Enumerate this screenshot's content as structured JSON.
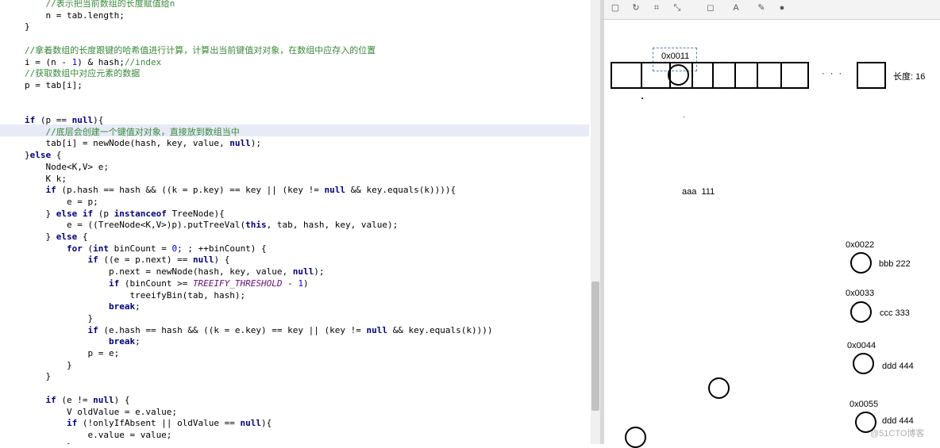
{
  "editor": {
    "lines": [
      [
        {
          "t": "    "
        },
        {
          "t": "//表示把当前数组的长度赋值给n",
          "s": "cc"
        }
      ],
      [
        {
          "t": "    n = tab.length;"
        }
      ],
      [
        {
          "t": "}"
        }
      ],
      [
        {
          "t": ""
        }
      ],
      [
        {
          "t": "//拿着数组的长度跟键的哈希值进行计算，计算出当前键值对对象，在数组中应存入的位置",
          "s": "cc"
        }
      ],
      [
        {
          "t": "i = (n - "
        },
        {
          "t": "1",
          "s": "n"
        },
        {
          "t": ") & hash;"
        },
        {
          "t": "//index",
          "s": "cc"
        }
      ],
      [
        {
          "t": "//获取数组中对应元素的数据",
          "s": "cc"
        }
      ],
      [
        {
          "t": "p = tab[i];"
        }
      ],
      [
        {
          "t": ""
        }
      ],
      [
        {
          "t": ""
        }
      ],
      [
        {
          "t": "if",
          "s": "k"
        },
        {
          "t": " (p == "
        },
        {
          "t": "null",
          "s": "k"
        },
        {
          "t": "){"
        }
      ],
      [
        {
          "t": "    "
        },
        {
          "t": "//底层会创建一个键值对对象，直接放到数组当中",
          "s": "cc"
        }
      ],
      [
        {
          "t": "    tab[i] = newNode(hash, key, value, "
        },
        {
          "t": "null",
          "s": "k"
        },
        {
          "t": ");"
        }
      ],
      [
        {
          "t": "}"
        },
        {
          "t": "else",
          "s": "k"
        },
        {
          "t": " {"
        }
      ],
      [
        {
          "t": "    Node<K,V> e;"
        }
      ],
      [
        {
          "t": "    K k;"
        }
      ],
      [
        {
          "t": "    "
        },
        {
          "t": "if",
          "s": "k"
        },
        {
          "t": " (p.hash == hash && ((k = p.key) == key || (key != "
        },
        {
          "t": "null",
          "s": "k"
        },
        {
          "t": " && key.equals(k))))"
        },
        {
          "t": "{"
        }
      ],
      [
        {
          "t": "        e = p;"
        }
      ],
      [
        {
          "t": "    } "
        },
        {
          "t": "else if",
          "s": "k"
        },
        {
          "t": " (p "
        },
        {
          "t": "instanceof",
          "s": "k"
        },
        {
          "t": " TreeNode){"
        }
      ],
      [
        {
          "t": "        e = ((TreeNode<K,V>)p).putTreeVal("
        },
        {
          "t": "this",
          "s": "k"
        },
        {
          "t": ", tab, hash, key, value);"
        }
      ],
      [
        {
          "t": "    } "
        },
        {
          "t": "else",
          "s": "k"
        },
        {
          "t": " {"
        }
      ],
      [
        {
          "t": "        "
        },
        {
          "t": "for",
          "s": "k"
        },
        {
          "t": " ("
        },
        {
          "t": "int",
          "s": "k"
        },
        {
          "t": " binCount = "
        },
        {
          "t": "0",
          "s": "n"
        },
        {
          "t": "; ; ++binCount) {"
        }
      ],
      [
        {
          "t": "            "
        },
        {
          "t": "if",
          "s": "k"
        },
        {
          "t": " ((e = p.next) == "
        },
        {
          "t": "null",
          "s": "k"
        },
        {
          "t": ") {"
        }
      ],
      [
        {
          "t": "                p.next = newNode(hash, key, value, "
        },
        {
          "t": "null",
          "s": "k"
        },
        {
          "t": ");"
        }
      ],
      [
        {
          "t": "                "
        },
        {
          "t": "if",
          "s": "k"
        },
        {
          "t": " (binCount >= "
        },
        {
          "t": "TREEIFY_THRESHOLD",
          "s": "f"
        },
        {
          "t": " - "
        },
        {
          "t": "1",
          "s": "n"
        },
        {
          "t": ")"
        }
      ],
      [
        {
          "t": "                    treeifyBin(tab, hash);"
        }
      ],
      [
        {
          "t": "                "
        },
        {
          "t": "break",
          "s": "k"
        },
        {
          "t": ";"
        }
      ],
      [
        {
          "t": "            }"
        }
      ],
      [
        {
          "t": "            "
        },
        {
          "t": "if",
          "s": "k"
        },
        {
          "t": " (e.hash == hash && ((k = e.key) == key || (key != "
        },
        {
          "t": "null",
          "s": "k"
        },
        {
          "t": " && key.equals(k))))"
        }
      ],
      [
        {
          "t": "                "
        },
        {
          "t": "break",
          "s": "k"
        },
        {
          "t": ";"
        }
      ],
      [
        {
          "t": "            p = e;"
        }
      ],
      [
        {
          "t": "        }"
        }
      ],
      [
        {
          "t": "    }"
        }
      ],
      [
        {
          "t": ""
        }
      ],
      [
        {
          "t": "    "
        },
        {
          "t": "if",
          "s": "k"
        },
        {
          "t": " (e != "
        },
        {
          "t": "null",
          "s": "k"
        },
        {
          "t": ") {"
        }
      ],
      [
        {
          "t": "        V oldValue = e.value;"
        }
      ],
      [
        {
          "t": "        "
        },
        {
          "t": "if",
          "s": "k"
        },
        {
          "t": " (!onlyIfAbsent || oldValue == "
        },
        {
          "t": "null",
          "s": "k"
        },
        {
          "t": "){"
        }
      ],
      [
        {
          "t": "            e.value = value;"
        }
      ],
      [
        {
          "t": "        }"
        }
      ]
    ]
  },
  "toolbar": {
    "icons": [
      "select-icon",
      "rotate-icon",
      "crop-icon",
      "resize-icon",
      "shapes-icon",
      "text-icon",
      "brush-icon",
      "color-icon"
    ]
  },
  "canvas": {
    "array_address": "0x0011",
    "ellipsis": "· · ·",
    "length_label": "长度: 16",
    "entry_aaa": "aaa  111",
    "nodes": [
      {
        "address": "0x0022",
        "label": "bbb 222"
      },
      {
        "address": "0x0033",
        "label": "ccc 333"
      },
      {
        "address": "0x0044",
        "label": "ddd 444"
      },
      {
        "address": "0x0055",
        "label": "ddd 444"
      }
    ]
  },
  "watermark": "@51CTO博客"
}
